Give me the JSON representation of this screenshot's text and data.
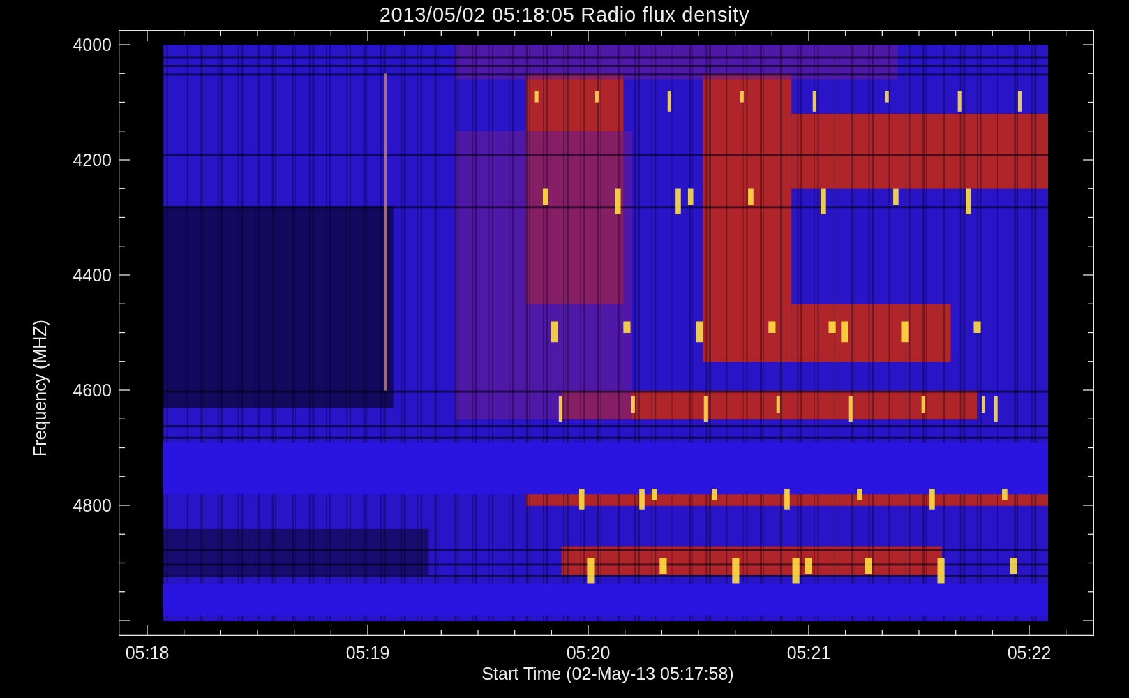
{
  "title": "2013/05/02 05:18:05 Radio flux density",
  "y_axis": {
    "label": "Frequency (MHZ)",
    "ticks": [
      "4000",
      "4200",
      "4400",
      "4600",
      "4800"
    ]
  },
  "x_axis": {
    "label": "Start Time (02-May-13 05:17:58)",
    "ticks": [
      "05:18",
      "05:19",
      "05:20",
      "05:21",
      "05:22"
    ]
  }
}
